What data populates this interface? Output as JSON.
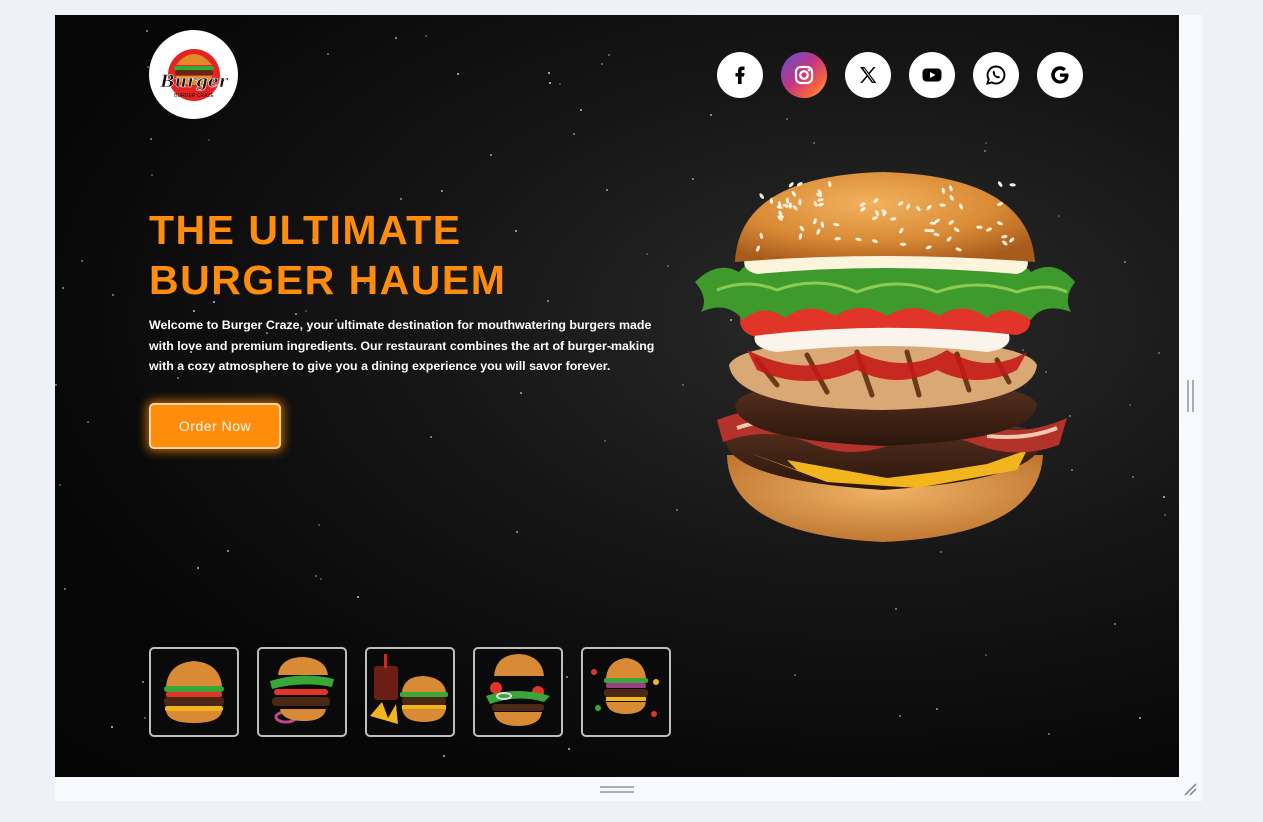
{
  "logo": {
    "text_top": "Burger",
    "text_bottom": "BURGER CRAZE"
  },
  "socials": [
    {
      "name": "facebook-icon",
      "label": "f"
    },
    {
      "name": "instagram-icon",
      "label": "instagram"
    },
    {
      "name": "x-icon",
      "label": "X"
    },
    {
      "name": "youtube-icon",
      "label": "youtube"
    },
    {
      "name": "whatsapp-icon",
      "label": "whatsapp"
    },
    {
      "name": "google-icon",
      "label": "G"
    }
  ],
  "hero": {
    "title_line1": "THE ULTIMATE",
    "title_line2": "BURGER HAUEM",
    "description": "Welcome to Burger Craze, your ultimate destination for mouthwatering burgers made with love and premium ingredients. Our restaurant combines the art of burger-making with a cozy atmosphere to give you a dining experience you will savor forever.",
    "order_button": "Order Now"
  },
  "colors": {
    "accent": "#ff8c0a",
    "background": "#0b0b0b",
    "page": "#eef2f8"
  }
}
